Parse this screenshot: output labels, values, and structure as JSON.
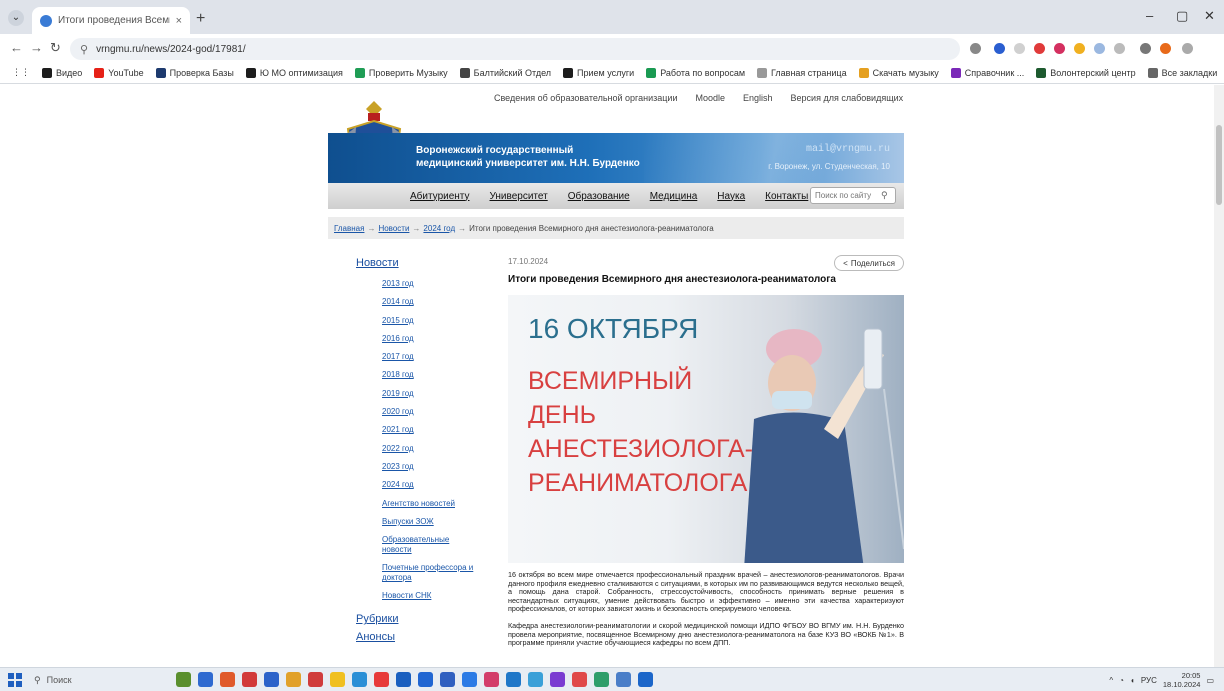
{
  "browser": {
    "tab_title": "Итоги проведения Всемирного",
    "tab_close": "×",
    "new_tab": "+",
    "url": "vrngmu.ru/news/2024-god/17981/",
    "window_controls": [
      "–",
      "▢",
      "✕"
    ],
    "bookmarks": [
      {
        "label": "Видео",
        "color": "#1d1d1d"
      },
      {
        "label": "YouTube",
        "color": "#e62117"
      },
      {
        "label": "Проверка Базы",
        "color": "#1d3a6e"
      },
      {
        "label": "Ю МО оптимизация",
        "color": "#1d1d1d"
      },
      {
        "label": "Проверить Музыку",
        "color": "#1f9d55"
      },
      {
        "label": "Балтийский Отдел",
        "color": "#444"
      },
      {
        "label": "Прием услуги",
        "color": "#1d1d1d"
      },
      {
        "label": "Работа по вопросам",
        "color": "#1a9a52"
      },
      {
        "label": "Главная страница",
        "color": "#999"
      },
      {
        "label": "Скачать музыку",
        "color": "#e5a020"
      },
      {
        "label": "Справочник ...",
        "color": "#7a28b8"
      },
      {
        "label": "Волонтерский центр",
        "color": "#1d5a2f"
      },
      {
        "label": "Все закладки",
        "color": "#666"
      }
    ]
  },
  "site": {
    "top_links": [
      "Сведения об образовательной организации",
      "Moodle",
      "English",
      "Версия для слабовидящих"
    ],
    "title_line1": "Воронежский государственный",
    "title_line2": "медицинский университет им. Н.Н. Бурденко",
    "email": "mail@vrngmu.ru",
    "address": "г. Воронеж, ул. Студенческая, 10",
    "nav": [
      "Абитуриенту",
      "Университет",
      "Образование",
      "Медицина",
      "Наука",
      "Контакты"
    ],
    "search_placeholder": "Поиск по сайту",
    "breadcrumb": [
      "Главная",
      "Новости",
      "2024 год",
      "Итоги проведения Всемирного дня анестезиолога-реаниматолога"
    ]
  },
  "sidebar": {
    "news_title": "Новости",
    "years": [
      "2013 год",
      "2014 год",
      "2015 год",
      "2016 год",
      "2017 год",
      "2018 год",
      "2019 год",
      "2020 год",
      "2021 год",
      "2022 год",
      "2023 год",
      "2024 год"
    ],
    "extra": [
      "Агентство новостей",
      "Выпуски ЗОЖ",
      "Образовательные новости",
      "Почетные профессора и доктора",
      "Новости СНК"
    ],
    "rubrics": "Рубрики",
    "announcements": "Анонсы"
  },
  "article": {
    "date": "17.10.2024",
    "share": "Поделиться",
    "title": "Итоги проведения Всемирного дня анестезиолога-реаниматолога",
    "hero": {
      "line1": "16 ОКТЯБРЯ",
      "line2": "ВСЕМИРНЫЙ",
      "line3": "ДЕНЬ",
      "line4": "АНЕСТЕЗИОЛОГА-",
      "line5": "РЕАНИМАТОЛОГА"
    },
    "para1": "16 октября во всем мире отмечается профессиональный праздник врачей – анестезиологов-реаниматологов. Врачи данного профиля ежедневно сталкиваются с ситуациями, в которых им по развивающимся ведутся несколько вещей, а помощь дана старой. Собранность, стрессоустойчивость, способность принимать верные решения в нестандартных ситуациях, умение действовать быстро и эффективно – именно эти качества характеризуют профессионалов, от которых зависят жизнь и безопасность оперируемого человека.",
    "para2": "Кафедра анестезиологии-реаниматологии и скорой медицинской помощи ИДПО ФГБОУ ВО ВГМУ им. Н.Н. Бурденко провела мероприятие, посвященное Всемирному дню анестезиолога-реаниматолога на базе КУЗ ВО «ВОКБ №1». В программе приняли участие обучающиеся кафедры по всем ДПП."
  },
  "taskbar": {
    "search": "Поиск",
    "clock_time": "20:05",
    "clock_date": "18.10.2024",
    "lang": "РУС",
    "app_colors": [
      "#5a8f2e",
      "#2f6ad0",
      "#e05a2b",
      "#d23a3a",
      "#2b62c9",
      "#e1a12a",
      "#d03c3c",
      "#f0c020",
      "#2a8fd6",
      "#e73a3a",
      "#1a5fbf",
      "#2066d2",
      "#3060c0",
      "#2c7be5",
      "#d33d6a",
      "#1f77c8",
      "#3aa0d8",
      "#7a3bd1",
      "#e04949",
      "#2e9e6a",
      "#4a7ec8",
      "#1b66c9"
    ]
  }
}
